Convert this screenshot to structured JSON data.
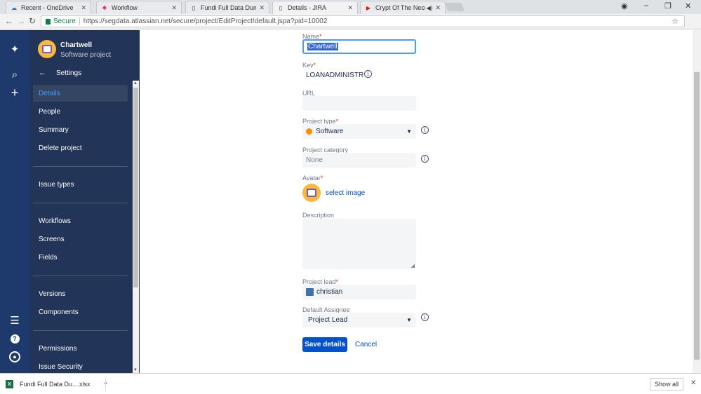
{
  "browser": {
    "tabs": [
      {
        "title": "Recent - OneDrive",
        "icon": "onedrive-icon",
        "active": false
      },
      {
        "title": "Workflow",
        "icon": "slack-icon",
        "active": false
      },
      {
        "title": "Fundi Full Data Dump Re",
        "icon": "document-icon",
        "active": false
      },
      {
        "title": "Details - JIRA",
        "icon": "document-icon",
        "active": true
      },
      {
        "title": "Crypt Of The Necrod",
        "icon": "youtube-icon",
        "active": false
      }
    ],
    "secure_label": "Secure",
    "url": "https://segdata.atlassian.net/secure/project/EditProject!default.jspa?pid=10002"
  },
  "sidebar": {
    "project_name": "Chartwell",
    "project_type": "Software project",
    "back_label": "Settings",
    "items": [
      {
        "label": "Details",
        "selected": true
      },
      {
        "label": "People"
      },
      {
        "label": "Summary"
      },
      {
        "label": "Delete project"
      },
      {
        "label": "Issue types"
      },
      {
        "label": "Workflows"
      },
      {
        "label": "Screens"
      },
      {
        "label": "Fields"
      },
      {
        "label": "Versions"
      },
      {
        "label": "Components"
      },
      {
        "label": "Permissions"
      },
      {
        "label": "Issue Security"
      }
    ]
  },
  "form": {
    "name_label": "Name",
    "name_value": "Chartwell",
    "key_label": "Key",
    "key_value": "LOANADMINISTR",
    "url_label": "URL",
    "url_value": "",
    "type_label": "Project type",
    "type_value": "Software",
    "category_label": "Project category",
    "category_value": "None",
    "avatar_label": "Avatar",
    "avatar_link": "select image",
    "description_label": "Description",
    "lead_label": "Project lead",
    "lead_value": "christian",
    "assignee_label": "Default Assignee",
    "assignee_value": "Project Lead",
    "save_label": "Save details",
    "cancel_label": "Cancel"
  },
  "downloads": {
    "file_name": "Fundi Full Data Du....xlsx",
    "show_all": "Show all"
  },
  "colors": {
    "sidebar_bg": "#223458",
    "accent": "#0052cc",
    "selected_text": "#4c9aff"
  }
}
